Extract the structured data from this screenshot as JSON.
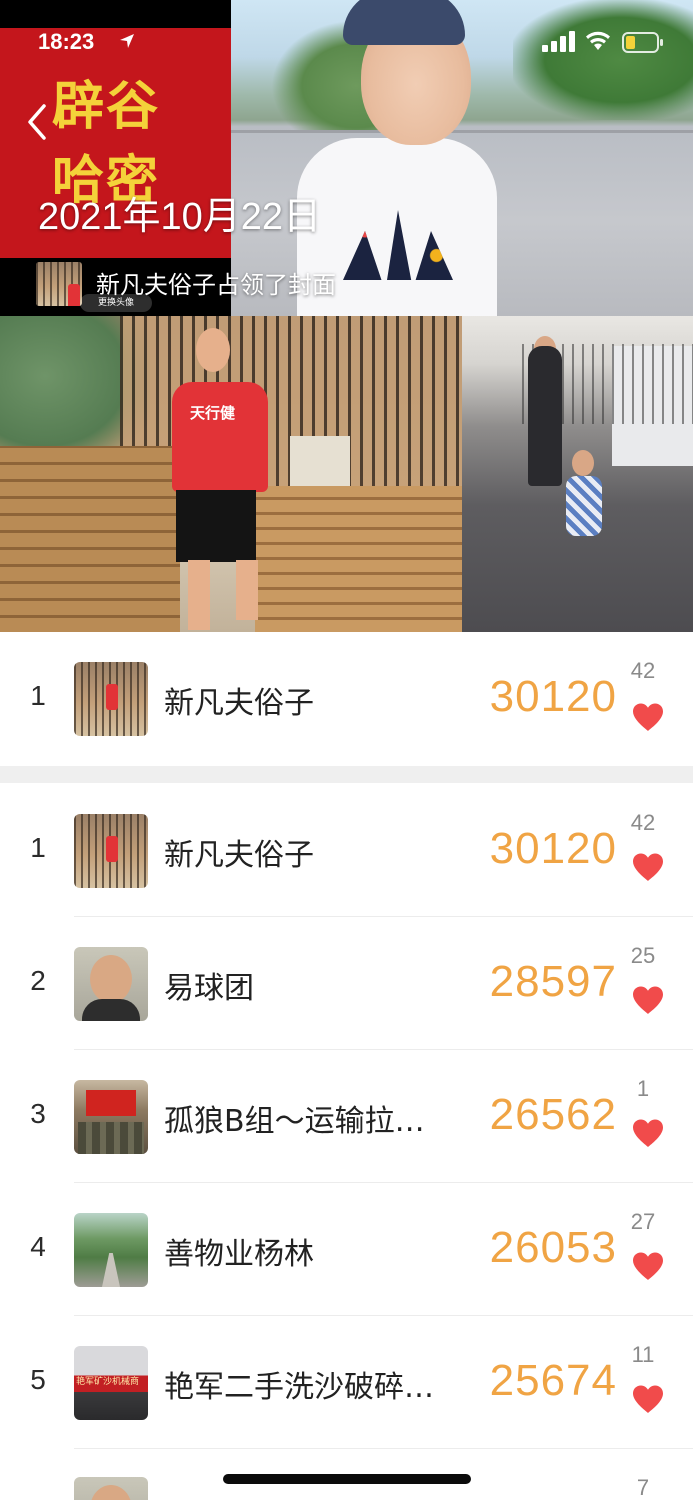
{
  "status_bar": {
    "time": "18:23",
    "location_icon": "location-arrow-icon",
    "signal_icon": "cellular-signal-icon",
    "wifi_icon": "wifi-icon",
    "battery_icon": "battery-low-icon",
    "battery_color": "#f4d23a"
  },
  "cover": {
    "title_line1": "辟谷",
    "title_line2": "哈密",
    "title_color": "#f4d23a",
    "title_bg_color": "#c4161c",
    "date": "2021年10月22日",
    "owner_text": "新凡夫俗子占领了封面",
    "change_avatar_label": "更换头像",
    "man_shirt_text": "天行健",
    "back_icon": "chevron-left-icon"
  },
  "colors": {
    "steps": "#f0a444",
    "heart": "#f14b4b",
    "likes": "#8a8a8a",
    "band": "#efefef"
  },
  "my_rank": {
    "rank": "1",
    "name": "新凡夫俗子",
    "steps": "30120",
    "likes": "42"
  },
  "ranking": [
    {
      "rank": "1",
      "name": "新凡夫俗子",
      "steps": "30120",
      "likes": "42",
      "avatar": "bridge-photo"
    },
    {
      "rank": "2",
      "name": "易球团",
      "steps": "28597",
      "likes": "25",
      "avatar": "man-portrait"
    },
    {
      "rank": "3",
      "name": "孤狼B组～运输拉…",
      "steps": "26562",
      "likes": "1",
      "avatar": "red-flag-group"
    },
    {
      "rank": "4",
      "name": "善物业杨林",
      "steps": "26053",
      "likes": "27",
      "avatar": "tree-avenue"
    },
    {
      "rank": "5",
      "name": "艳军二手洗沙破碎…",
      "steps": "25674",
      "likes": "11",
      "avatar": "shop-sign",
      "avatar_sign_text": "艳军矿沙机械商"
    },
    {
      "likes": "7"
    }
  ]
}
